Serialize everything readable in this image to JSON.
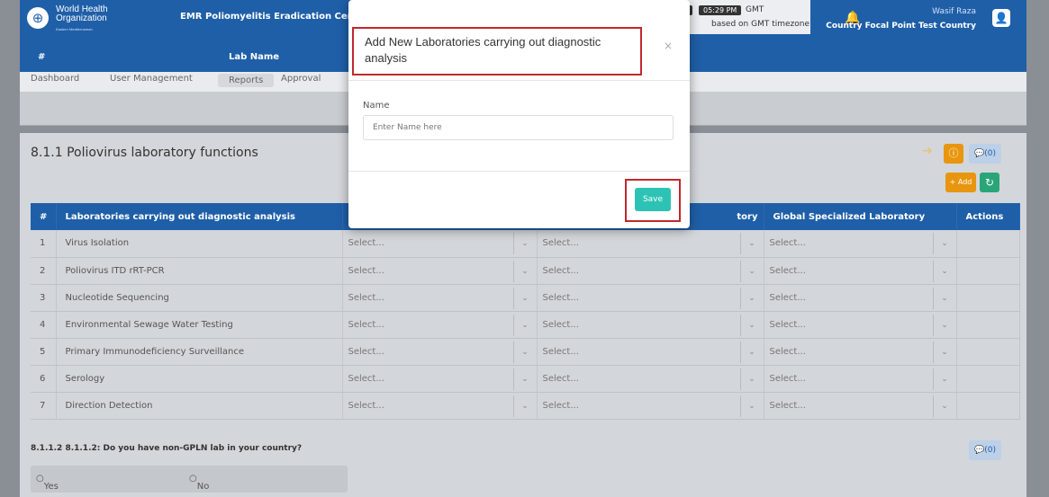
{
  "header": {
    "org_line1": "World Health",
    "org_line2": "Organization",
    "org_region": "Eastern Mediterranean",
    "app_title": "EMR Poliomyelitis Eradication Certificatio",
    "date": "14-03-2023",
    "time": "05:29 PM",
    "tz": "GMT",
    "tz_note": "based on GMT timezone",
    "user_name": "Wasif Raza",
    "user_role": "Country Focal Point Test Country"
  },
  "subheader": {
    "hash": "#",
    "lab_name": "Lab Name"
  },
  "nav": {
    "items": [
      "Dashboard",
      "User Management",
      "Reports",
      "Approval"
    ]
  },
  "section": {
    "title": "8.1.1 Poliovirus laboratory functions",
    "comment_count": "(0)",
    "add_label": "Add"
  },
  "table": {
    "headers": [
      "#",
      "Laboratories carrying out diagnostic analysis",
      "",
      "tory",
      "Global Specialized Laboratory",
      "Actions"
    ],
    "select_placeholder": "Select...",
    "rows": [
      {
        "n": "1",
        "name": "Virus Isolation"
      },
      {
        "n": "2",
        "name": "Poliovirus ITD rRT-PCR"
      },
      {
        "n": "3",
        "name": "Nucleotide Sequencing"
      },
      {
        "n": "4",
        "name": "Environmental Sewage Water Testing"
      },
      {
        "n": "5",
        "name": "Primary Immunodeficiency Surveillance"
      },
      {
        "n": "6",
        "name": "Serology"
      },
      {
        "n": "7",
        "name": "Direction Detection"
      }
    ]
  },
  "question": {
    "text": "8.1.1.2 8.1.1.2: Do you have non-GPLN lab in your country?",
    "comment_count": "(0)",
    "yes": "Yes",
    "no": "No"
  },
  "modal": {
    "title": "Add New Laboratories carrying out diagnostic analysis",
    "close": "×",
    "name_label": "Name",
    "name_placeholder": "Enter Name here",
    "save_label": "Save"
  },
  "colors": {
    "brand": "#1f5fa8",
    "save": "#2dc3b4",
    "highlight": "#c0282d",
    "warning": "#e8960f"
  }
}
